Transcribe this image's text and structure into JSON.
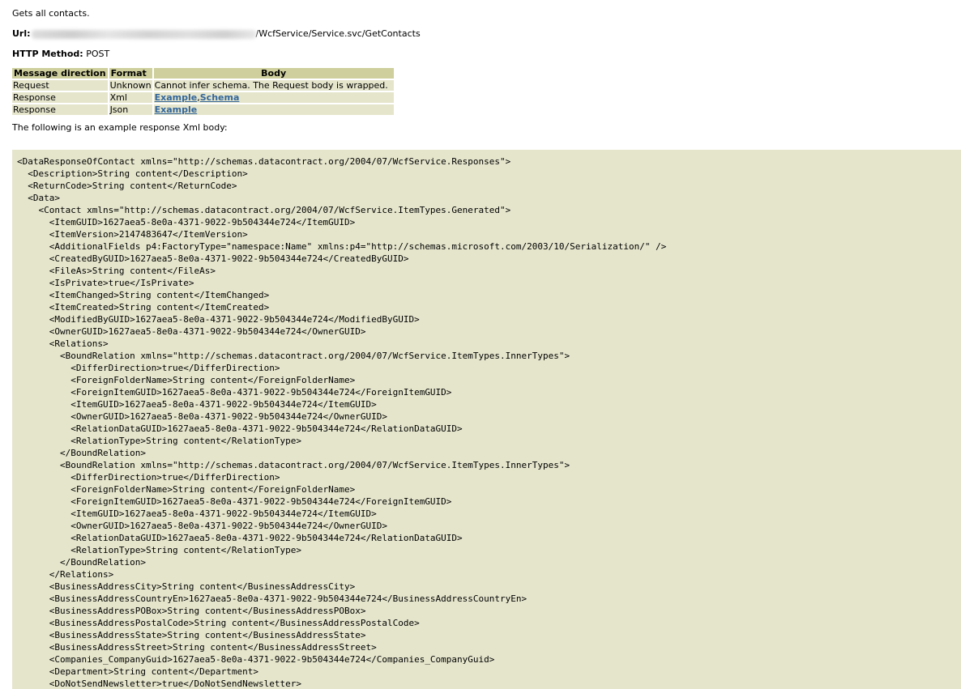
{
  "description": "Gets all contacts.",
  "url": {
    "label": "Url:",
    "suffix": "/WcfService/Service.svc/GetContacts"
  },
  "method": {
    "label": "HTTP Method:",
    "value": "POST"
  },
  "table": {
    "headers": [
      "Message direction",
      "Format",
      "Body"
    ],
    "rows": [
      {
        "direction": "Request",
        "format": "Unknown",
        "body": "Cannot infer schema. The Request body is wrapped."
      },
      {
        "direction": "Response",
        "format": "Xml",
        "link1": "Example",
        "sep": ",",
        "link2": "Schema"
      },
      {
        "direction": "Response",
        "format": "Json",
        "link1": "Example"
      }
    ]
  },
  "example_intro": "The following is an example response Xml body:",
  "code_lines": [
    "<DataResponseOfContact xmlns=\"http://schemas.datacontract.org/2004/07/WcfService.Responses\">",
    "  <Description>String content</Description>",
    "  <ReturnCode>String content</ReturnCode>",
    "  <Data>",
    "    <Contact xmlns=\"http://schemas.datacontract.org/2004/07/WcfService.ItemTypes.Generated\">",
    "      <ItemGUID>1627aea5-8e0a-4371-9022-9b504344e724</ItemGUID>",
    "      <ItemVersion>2147483647</ItemVersion>",
    "      <AdditionalFields p4:FactoryType=\"namespace:Name\" xmlns:p4=\"http://schemas.microsoft.com/2003/10/Serialization/\" />",
    "      <CreatedByGUID>1627aea5-8e0a-4371-9022-9b504344e724</CreatedByGUID>",
    "      <FileAs>String content</FileAs>",
    "      <IsPrivate>true</IsPrivate>",
    "      <ItemChanged>String content</ItemChanged>",
    "      <ItemCreated>String content</ItemCreated>",
    "      <ModifiedByGUID>1627aea5-8e0a-4371-9022-9b504344e724</ModifiedByGUID>",
    "      <OwnerGUID>1627aea5-8e0a-4371-9022-9b504344e724</OwnerGUID>",
    "      <Relations>",
    "        <BoundRelation xmlns=\"http://schemas.datacontract.org/2004/07/WcfService.ItemTypes.InnerTypes\">",
    "          <DifferDirection>true</DifferDirection>",
    "          <ForeignFolderName>String content</ForeignFolderName>",
    "          <ForeignItemGUID>1627aea5-8e0a-4371-9022-9b504344e724</ForeignItemGUID>",
    "          <ItemGUID>1627aea5-8e0a-4371-9022-9b504344e724</ItemGUID>",
    "          <OwnerGUID>1627aea5-8e0a-4371-9022-9b504344e724</OwnerGUID>",
    "          <RelationDataGUID>1627aea5-8e0a-4371-9022-9b504344e724</RelationDataGUID>",
    "          <RelationType>String content</RelationType>",
    "        </BoundRelation>",
    "        <BoundRelation xmlns=\"http://schemas.datacontract.org/2004/07/WcfService.ItemTypes.InnerTypes\">",
    "          <DifferDirection>true</DifferDirection>",
    "          <ForeignFolderName>String content</ForeignFolderName>",
    "          <ForeignItemGUID>1627aea5-8e0a-4371-9022-9b504344e724</ForeignItemGUID>",
    "          <ItemGUID>1627aea5-8e0a-4371-9022-9b504344e724</ItemGUID>",
    "          <OwnerGUID>1627aea5-8e0a-4371-9022-9b504344e724</OwnerGUID>",
    "          <RelationDataGUID>1627aea5-8e0a-4371-9022-9b504344e724</RelationDataGUID>",
    "          <RelationType>String content</RelationType>",
    "        </BoundRelation>",
    "      </Relations>",
    "      <BusinessAddressCity>String content</BusinessAddressCity>",
    "      <BusinessAddressCountryEn>1627aea5-8e0a-4371-9022-9b504344e724</BusinessAddressCountryEn>",
    "      <BusinessAddressPOBox>String content</BusinessAddressPOBox>",
    "      <BusinessAddressPostalCode>String content</BusinessAddressPostalCode>",
    "      <BusinessAddressState>String content</BusinessAddressState>",
    "      <BusinessAddressStreet>String content</BusinessAddressStreet>",
    "      <Companies_CompanyGuid>1627aea5-8e0a-4371-9022-9b504344e724</Companies_CompanyGuid>",
    "      <Department>String content</Department>",
    "      <DoNotSendNewsletter>true</DoNotSendNewsletter>"
  ]
}
